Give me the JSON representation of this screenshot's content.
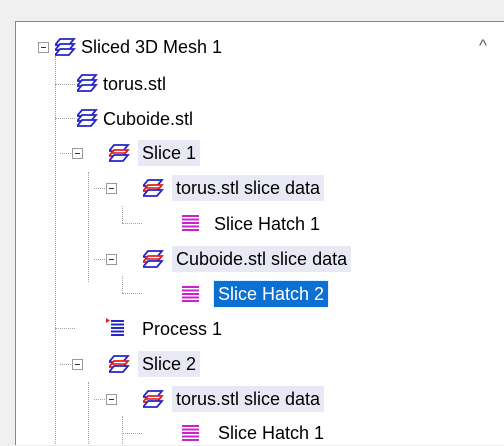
{
  "tree": {
    "root": {
      "label": "Sliced 3D Mesh 1",
      "icon": "mesh-blue-icon"
    },
    "items": [
      {
        "label": "torus.stl",
        "icon": "mesh-blue-icon"
      },
      {
        "label": "Cuboide.stl",
        "icon": "mesh-blue-icon"
      },
      {
        "label": "Slice 1",
        "icon": "slice-mesh-icon"
      },
      {
        "label": "torus.stl slice data",
        "icon": "slice-mesh-icon"
      },
      {
        "label": "Slice Hatch 1",
        "icon": "hatch-magenta-icon"
      },
      {
        "label": "Cuboide.stl slice data",
        "icon": "slice-mesh-icon"
      },
      {
        "label": "Slice Hatch 2",
        "icon": "hatch-magenta-icon",
        "selected": true
      },
      {
        "label": "Process 1",
        "icon": "process-list-icon"
      },
      {
        "label": "Slice 2",
        "icon": "slice-mesh-icon"
      },
      {
        "label": "torus.stl slice data",
        "icon": "slice-mesh-icon"
      },
      {
        "label": "Slice Hatch 1",
        "icon": "hatch-magenta-icon"
      }
    ]
  },
  "scrollbar": {
    "up_glyph": "^"
  },
  "colors": {
    "selection": "#0c6fd2",
    "parent_highlight": "#e9e9f6",
    "mesh_blue": "#2626c8",
    "slice_red": "#e02020",
    "hatch": "#cc22cc"
  }
}
